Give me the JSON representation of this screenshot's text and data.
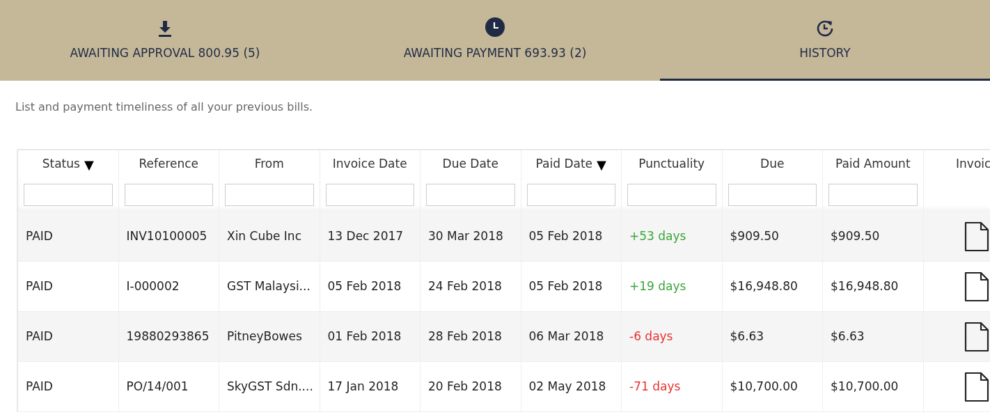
{
  "tabs": [
    {
      "label": "AWAITING APPROVAL 800.95 (5)",
      "selected": false
    },
    {
      "label": "AWAITING PAYMENT 693.93 (2)",
      "selected": false
    },
    {
      "label": "HISTORY",
      "selected": true
    }
  ],
  "description": "List and payment timeliness of all your previous bills.",
  "table": {
    "columns": [
      {
        "label": "Status",
        "sort_mark": "▼",
        "filter": true
      },
      {
        "label": "Reference",
        "filter": true
      },
      {
        "label": "From",
        "filter": true
      },
      {
        "label": "Invoice Date",
        "filter": true
      },
      {
        "label": "Due Date",
        "filter": true
      },
      {
        "label": "Paid Date",
        "sort_mark": "▼",
        "filter": true
      },
      {
        "label": "Punctuality",
        "filter": true
      },
      {
        "label": "Due",
        "filter": true
      },
      {
        "label": "Paid Amount",
        "filter": true
      },
      {
        "label": "Invoic",
        "filter": false
      }
    ],
    "rows": [
      {
        "status": "PAID",
        "reference": "INV10100005",
        "from": "Xin Cube Inc",
        "invoice_date": "13 Dec 2017",
        "due_date": "30 Mar 2018",
        "paid_date": "05 Feb 2018",
        "punctuality": "+53 days",
        "kind": "early",
        "due": "$909.50",
        "paid_amount": "$909.50"
      },
      {
        "status": "PAID",
        "reference": "I-000002",
        "from": "GST Malaysi...",
        "invoice_date": "05 Feb 2018",
        "due_date": "24 Feb 2018",
        "paid_date": "05 Feb 2018",
        "punctuality": "+19 days",
        "kind": "early",
        "due": "$16,948.80",
        "paid_amount": "$16,948.80"
      },
      {
        "status": "PAID",
        "reference": "19880293865",
        "from": "PitneyBowes",
        "invoice_date": "01 Feb 2018",
        "due_date": "28 Feb 2018",
        "paid_date": "06 Mar 2018",
        "punctuality": "-6 days",
        "kind": "late",
        "due": "$6.63",
        "paid_amount": "$6.63"
      },
      {
        "status": "PAID",
        "reference": "PO/14/001",
        "from": "SkyGST Sdn....",
        "invoice_date": "17 Jan 2018",
        "due_date": "20 Feb 2018",
        "paid_date": "02 May 2018",
        "punctuality": "-71 days",
        "kind": "late",
        "due": "$10,700.00",
        "paid_amount": "$10,700.00"
      }
    ]
  }
}
